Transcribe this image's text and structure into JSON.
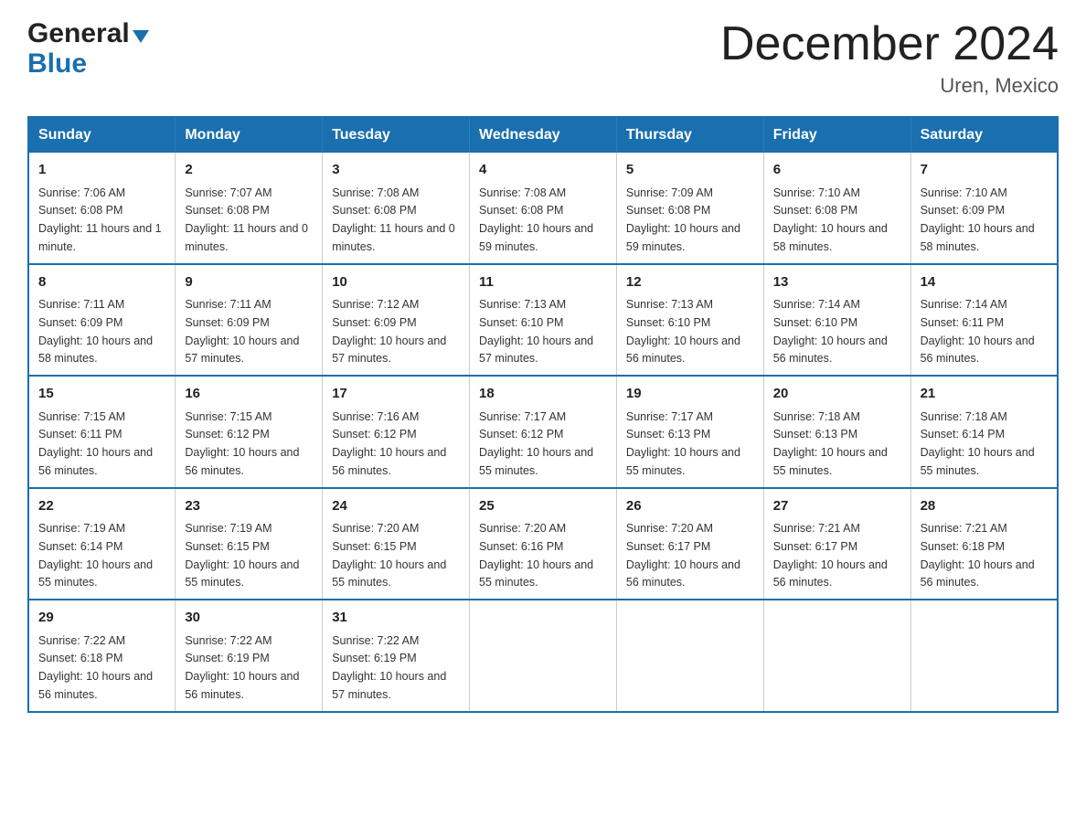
{
  "header": {
    "logo_general": "General",
    "logo_blue": "Blue",
    "month_title": "December 2024",
    "location": "Uren, Mexico"
  },
  "weekdays": [
    "Sunday",
    "Monday",
    "Tuesday",
    "Wednesday",
    "Thursday",
    "Friday",
    "Saturday"
  ],
  "weeks": [
    [
      {
        "day": "1",
        "sunrise": "7:06 AM",
        "sunset": "6:08 PM",
        "daylight": "11 hours and 1 minute."
      },
      {
        "day": "2",
        "sunrise": "7:07 AM",
        "sunset": "6:08 PM",
        "daylight": "11 hours and 0 minutes."
      },
      {
        "day": "3",
        "sunrise": "7:08 AM",
        "sunset": "6:08 PM",
        "daylight": "11 hours and 0 minutes."
      },
      {
        "day": "4",
        "sunrise": "7:08 AM",
        "sunset": "6:08 PM",
        "daylight": "10 hours and 59 minutes."
      },
      {
        "day": "5",
        "sunrise": "7:09 AM",
        "sunset": "6:08 PM",
        "daylight": "10 hours and 59 minutes."
      },
      {
        "day": "6",
        "sunrise": "7:10 AM",
        "sunset": "6:08 PM",
        "daylight": "10 hours and 58 minutes."
      },
      {
        "day": "7",
        "sunrise": "7:10 AM",
        "sunset": "6:09 PM",
        "daylight": "10 hours and 58 minutes."
      }
    ],
    [
      {
        "day": "8",
        "sunrise": "7:11 AM",
        "sunset": "6:09 PM",
        "daylight": "10 hours and 58 minutes."
      },
      {
        "day": "9",
        "sunrise": "7:11 AM",
        "sunset": "6:09 PM",
        "daylight": "10 hours and 57 minutes."
      },
      {
        "day": "10",
        "sunrise": "7:12 AM",
        "sunset": "6:09 PM",
        "daylight": "10 hours and 57 minutes."
      },
      {
        "day": "11",
        "sunrise": "7:13 AM",
        "sunset": "6:10 PM",
        "daylight": "10 hours and 57 minutes."
      },
      {
        "day": "12",
        "sunrise": "7:13 AM",
        "sunset": "6:10 PM",
        "daylight": "10 hours and 56 minutes."
      },
      {
        "day": "13",
        "sunrise": "7:14 AM",
        "sunset": "6:10 PM",
        "daylight": "10 hours and 56 minutes."
      },
      {
        "day": "14",
        "sunrise": "7:14 AM",
        "sunset": "6:11 PM",
        "daylight": "10 hours and 56 minutes."
      }
    ],
    [
      {
        "day": "15",
        "sunrise": "7:15 AM",
        "sunset": "6:11 PM",
        "daylight": "10 hours and 56 minutes."
      },
      {
        "day": "16",
        "sunrise": "7:15 AM",
        "sunset": "6:12 PM",
        "daylight": "10 hours and 56 minutes."
      },
      {
        "day": "17",
        "sunrise": "7:16 AM",
        "sunset": "6:12 PM",
        "daylight": "10 hours and 56 minutes."
      },
      {
        "day": "18",
        "sunrise": "7:17 AM",
        "sunset": "6:12 PM",
        "daylight": "10 hours and 55 minutes."
      },
      {
        "day": "19",
        "sunrise": "7:17 AM",
        "sunset": "6:13 PM",
        "daylight": "10 hours and 55 minutes."
      },
      {
        "day": "20",
        "sunrise": "7:18 AM",
        "sunset": "6:13 PM",
        "daylight": "10 hours and 55 minutes."
      },
      {
        "day": "21",
        "sunrise": "7:18 AM",
        "sunset": "6:14 PM",
        "daylight": "10 hours and 55 minutes."
      }
    ],
    [
      {
        "day": "22",
        "sunrise": "7:19 AM",
        "sunset": "6:14 PM",
        "daylight": "10 hours and 55 minutes."
      },
      {
        "day": "23",
        "sunrise": "7:19 AM",
        "sunset": "6:15 PM",
        "daylight": "10 hours and 55 minutes."
      },
      {
        "day": "24",
        "sunrise": "7:20 AM",
        "sunset": "6:15 PM",
        "daylight": "10 hours and 55 minutes."
      },
      {
        "day": "25",
        "sunrise": "7:20 AM",
        "sunset": "6:16 PM",
        "daylight": "10 hours and 55 minutes."
      },
      {
        "day": "26",
        "sunrise": "7:20 AM",
        "sunset": "6:17 PM",
        "daylight": "10 hours and 56 minutes."
      },
      {
        "day": "27",
        "sunrise": "7:21 AM",
        "sunset": "6:17 PM",
        "daylight": "10 hours and 56 minutes."
      },
      {
        "day": "28",
        "sunrise": "7:21 AM",
        "sunset": "6:18 PM",
        "daylight": "10 hours and 56 minutes."
      }
    ],
    [
      {
        "day": "29",
        "sunrise": "7:22 AM",
        "sunset": "6:18 PM",
        "daylight": "10 hours and 56 minutes."
      },
      {
        "day": "30",
        "sunrise": "7:22 AM",
        "sunset": "6:19 PM",
        "daylight": "10 hours and 56 minutes."
      },
      {
        "day": "31",
        "sunrise": "7:22 AM",
        "sunset": "6:19 PM",
        "daylight": "10 hours and 57 minutes."
      },
      null,
      null,
      null,
      null
    ]
  ],
  "labels": {
    "sunrise": "Sunrise:",
    "sunset": "Sunset:",
    "daylight": "Daylight:"
  }
}
